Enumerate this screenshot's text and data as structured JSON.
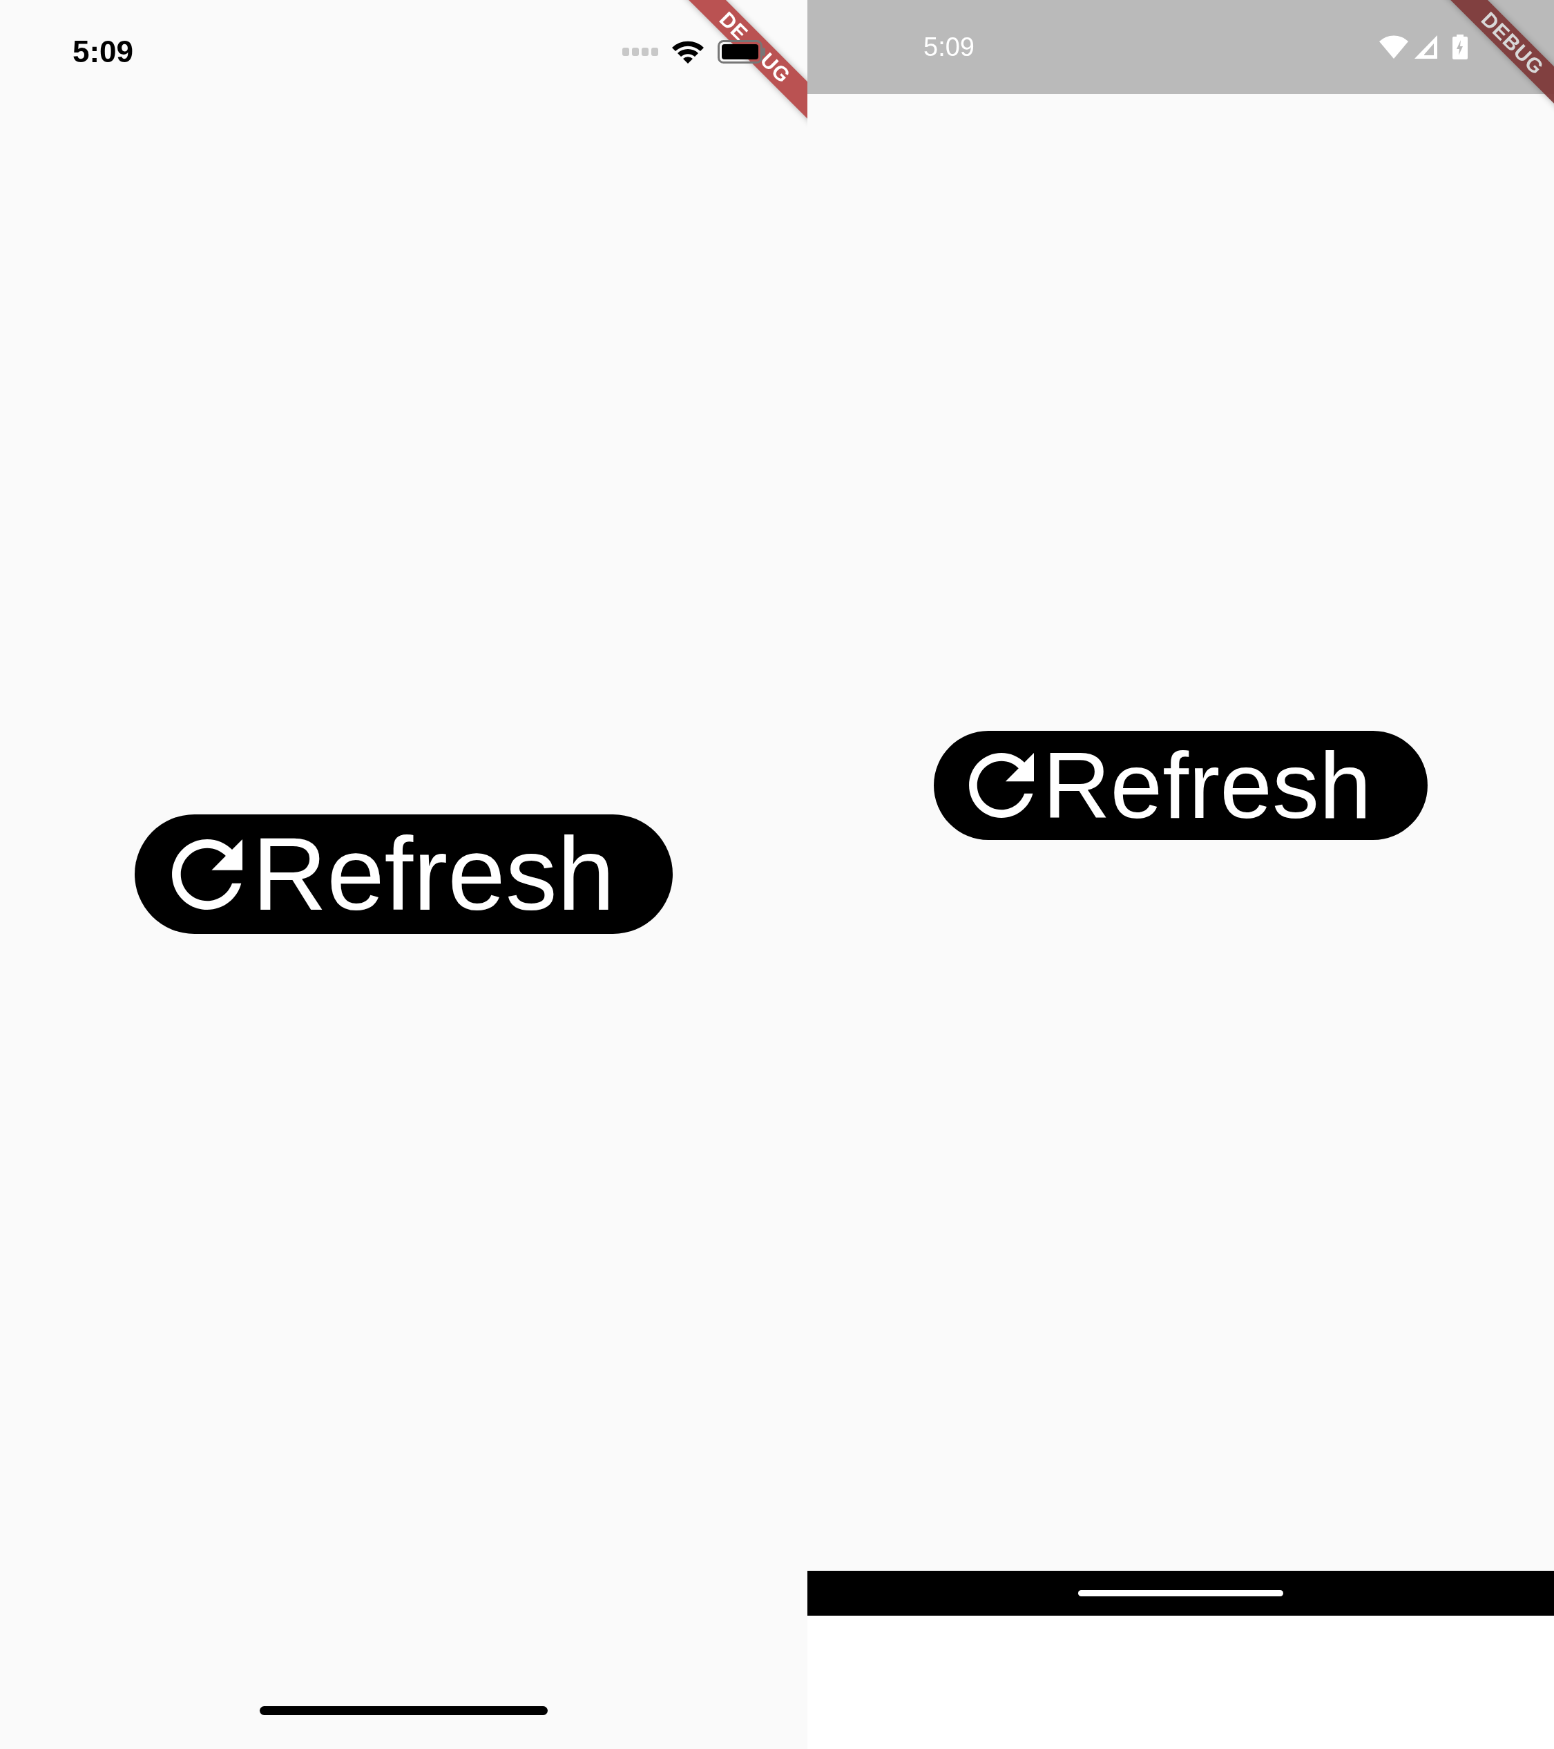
{
  "screens": [
    {
      "kind": "ios",
      "status_bar": {
        "time": "5:09"
      },
      "button": {
        "label": "Refresh"
      },
      "debug_banner": [
        "DE",
        "UG"
      ]
    },
    {
      "kind": "android",
      "status_bar": {
        "time": "5:09"
      },
      "button": {
        "label": "Refresh"
      },
      "debug_banner": [
        "DEBUG"
      ]
    }
  ]
}
